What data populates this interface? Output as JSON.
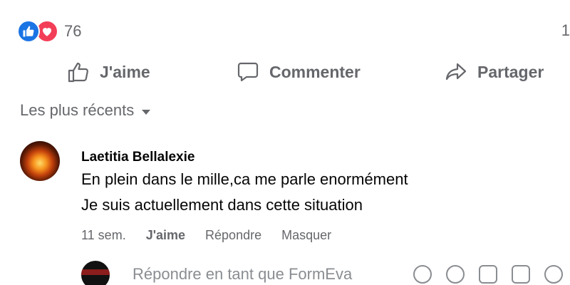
{
  "reactions": {
    "count": "76",
    "right_count": "1",
    "icons": [
      "like-icon",
      "love-icon"
    ],
    "colors": {
      "like": "#1b74e4",
      "love": "#f33e58"
    }
  },
  "actions": {
    "like_label": "J'aime",
    "comment_label": "Commenter",
    "share_label": "Partager"
  },
  "sort": {
    "label": "Les plus récents"
  },
  "comment": {
    "author": "Laetitia Bellalexie",
    "lines": [
      "En plein dans le mille,ca me parle enormément",
      "Je suis actuellement dans cette situation"
    ],
    "time": "11 sem.",
    "like_label": "J'aime",
    "reply_label": "Répondre",
    "hide_label": "Masquer"
  },
  "reply": {
    "placeholder": "Répondre en tant que FormEva"
  }
}
